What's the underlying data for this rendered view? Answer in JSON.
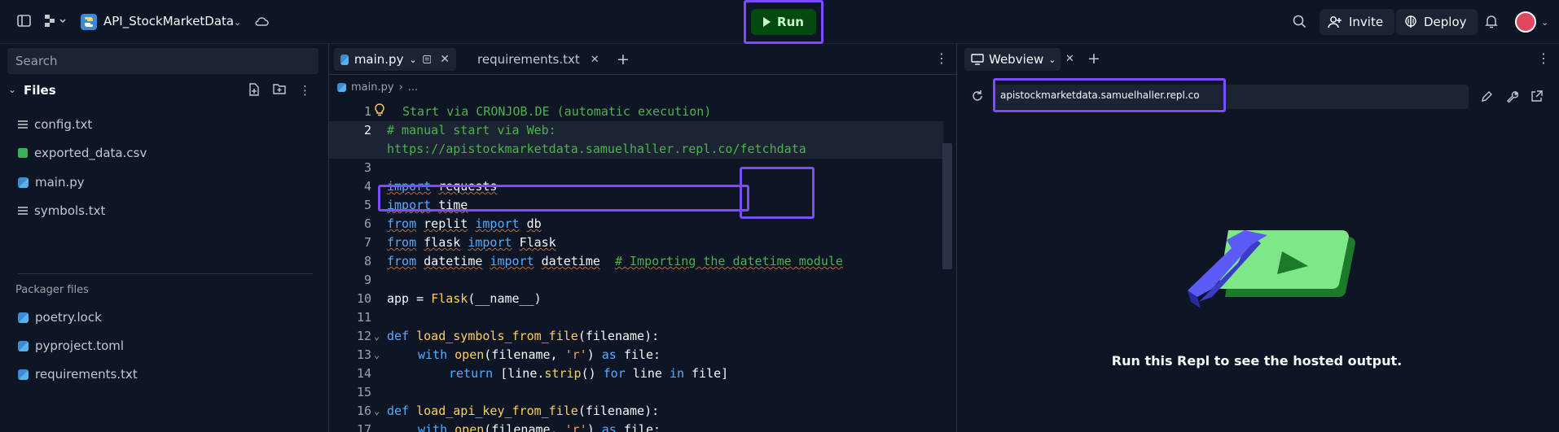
{
  "topbar": {
    "repl_name": "API_StockMarketData",
    "run_label": "Run",
    "invite_label": "Invite",
    "deploy_label": "Deploy"
  },
  "sidebar": {
    "search_placeholder": "Search",
    "files_title": "Files",
    "files": [
      {
        "name": "config.txt",
        "icon": "text-file-icon"
      },
      {
        "name": "exported_data.csv",
        "icon": "csv-file-icon"
      },
      {
        "name": "main.py",
        "icon": "python-file-icon"
      },
      {
        "name": "symbols.txt",
        "icon": "text-file-icon"
      }
    ],
    "packager_title": "Packager files",
    "packager_files": [
      {
        "name": "poetry.lock",
        "icon": "python-file-icon"
      },
      {
        "name": "pyproject.toml",
        "icon": "python-file-icon"
      },
      {
        "name": "requirements.txt",
        "icon": "python-file-icon"
      }
    ]
  },
  "editor": {
    "tabs": [
      {
        "label": "main.py",
        "active": true
      },
      {
        "label": "requirements.txt",
        "active": false
      }
    ],
    "breadcrumb": [
      "main.py",
      "..."
    ],
    "lines": {
      "l1": "Start via CRONJOB.DE (automatic execution)",
      "l2": "# manual start via Web:",
      "l2b": "https://apistockmarketdata.samuelhaller.repl.co/fetchdata",
      "l4a": "import",
      "l4b": "requests",
      "l5a": "import",
      "l5b": "time",
      "l6a": "from",
      "l6b": "replit",
      "l6c": "import",
      "l6d": "db",
      "l7a": "from",
      "l7b": "flask",
      "l7c": "import",
      "l7d": "Flask",
      "l8a": "from",
      "l8b": "datetime",
      "l8c": "import",
      "l8d": "datetime",
      "l8e": "# Importing the datetime module",
      "l10a": "app = ",
      "l10b": "Flask",
      "l10c": "(__name__)",
      "l12a": "def",
      "l12b": "load_symbols_from_file",
      "l12c": "(filename):",
      "l13a": "with",
      "l13b": "open",
      "l13c": "(filename, ",
      "l13d": "'r'",
      "l13e": ") ",
      "l13f": "as",
      "l13g": " file:",
      "l14a": "return",
      "l14b": " [line.",
      "l14c": "strip",
      "l14d": "() ",
      "l14e": "for",
      "l14f": " line ",
      "l14g": "in",
      "l14h": " file]",
      "l16a": "def",
      "l16b": "load_api_key_from_file",
      "l16c": "(filename):",
      "l17a": "with",
      "l17b": "open",
      "l17c": "(filename, ",
      "l17d": "'r'",
      "l17e": ") ",
      "l17f": "as",
      "l17g": " file:"
    }
  },
  "webview": {
    "tab_label": "Webview",
    "url": "apistockmarketdata.samuelhaller.repl.co",
    "message": "Run this Repl to see the hosted output."
  }
}
